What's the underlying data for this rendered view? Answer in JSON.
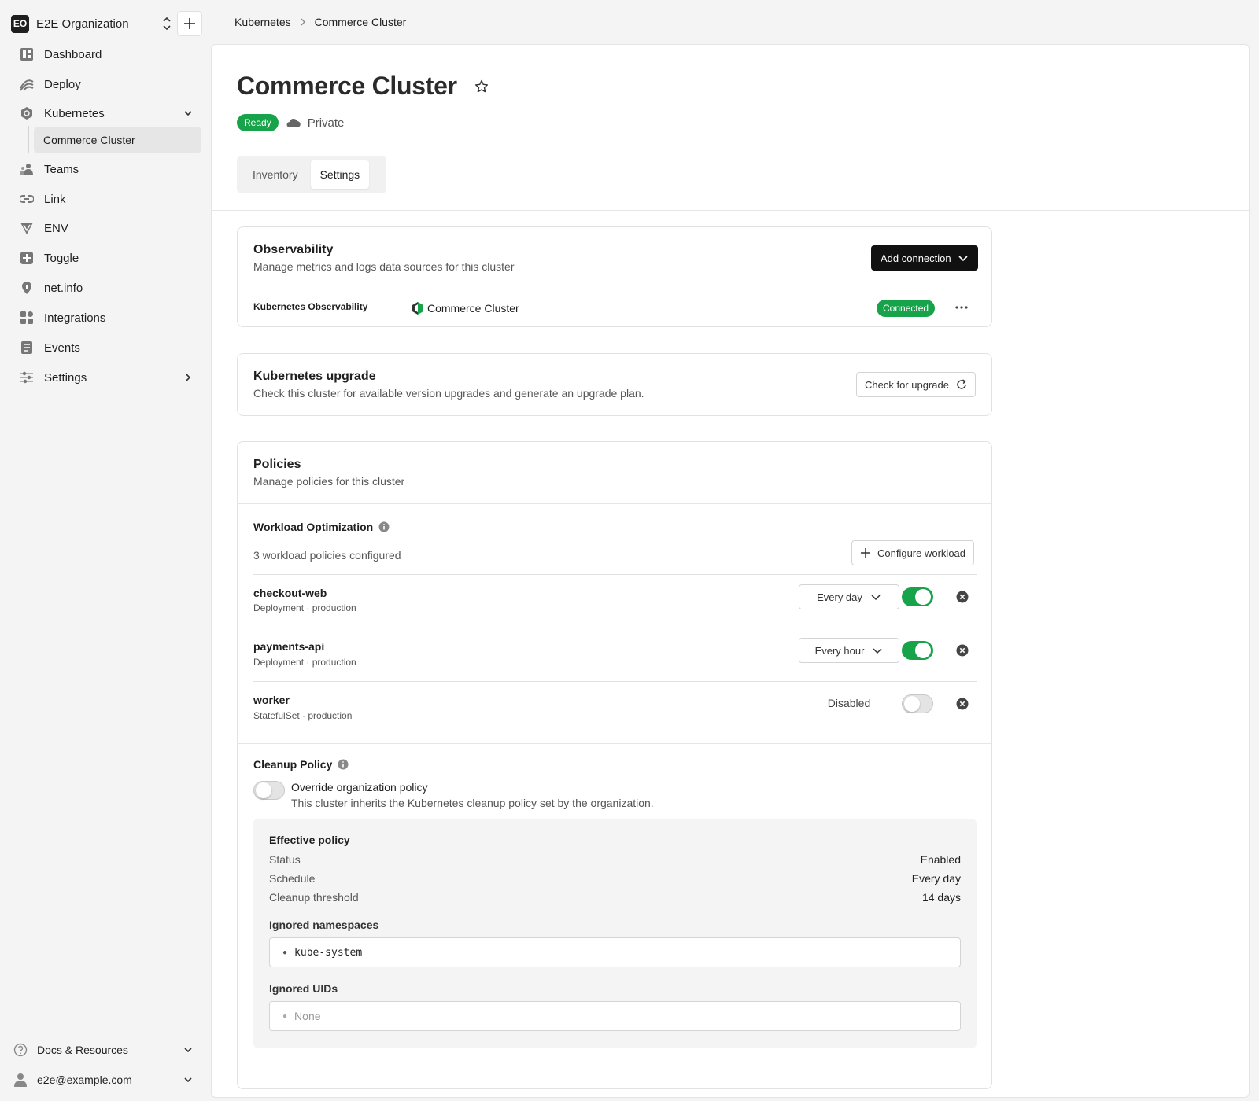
{
  "org": {
    "initials": "EO",
    "name": "E2E Organization"
  },
  "sidebar": {
    "items": [
      {
        "label": "Dashboard",
        "icon": "dashboard-icon"
      },
      {
        "label": "Deploy",
        "icon": "deploy-icon"
      },
      {
        "label": "Kubernetes",
        "icon": "kubernetes-icon"
      },
      {
        "label": "Teams",
        "icon": "teams-icon"
      },
      {
        "label": "Link",
        "icon": "link-icon"
      },
      {
        "label": "ENV",
        "icon": "env-icon"
      },
      {
        "label": "Toggle",
        "icon": "toggle-icon"
      },
      {
        "label": "net.info",
        "icon": "location-pin-icon"
      },
      {
        "label": "Integrations",
        "icon": "integrations-icon"
      },
      {
        "label": "Events",
        "icon": "events-icon"
      },
      {
        "label": "Settings",
        "icon": "settings-icon"
      }
    ],
    "sub_item": "Commerce Cluster",
    "docs": "Docs & Resources",
    "user": "e2e@example.com"
  },
  "breadcrumb": {
    "parent": "Kubernetes",
    "current": "Commerce Cluster"
  },
  "page": {
    "title": "Commerce Cluster",
    "status": "Ready",
    "visibility": "Private",
    "tabs": [
      "Inventory",
      "Settings"
    ],
    "active_tab": "Settings"
  },
  "observability": {
    "title": "Observability",
    "subtitle": "Manage metrics and logs data sources for this cluster",
    "add_button": "Add connection",
    "connection": {
      "name": "Kubernetes Observability",
      "cluster": "Commerce Cluster",
      "status": "Connected"
    }
  },
  "upgrade": {
    "title": "Kubernetes upgrade",
    "subtitle": "Check this cluster for available version upgrades and generate an upgrade plan.",
    "button": "Check for upgrade"
  },
  "policies": {
    "title": "Policies",
    "subtitle": "Manage policies for this cluster",
    "workload": {
      "title": "Workload Optimization",
      "summary": "3 workload policies configured",
      "configure_button": "Configure workload",
      "rows": [
        {
          "name": "checkout-web",
          "meta": "Deployment · production",
          "schedule": "Every day",
          "enabled": true
        },
        {
          "name": "payments-api",
          "meta": "Deployment · production",
          "schedule": "Every hour",
          "enabled": true
        },
        {
          "name": "worker",
          "meta": "StatefulSet · production",
          "schedule": "Disabled",
          "enabled": false
        }
      ]
    },
    "cleanup": {
      "title": "Cleanup Policy",
      "override_label": "Override organization policy",
      "override_desc": "This cluster inherits the Kubernetes cleanup policy set by the organization.",
      "override_enabled": false,
      "effective": {
        "title": "Effective policy",
        "status_label": "Status",
        "status_value": "Enabled",
        "schedule_label": "Schedule",
        "schedule_value": "Every day",
        "threshold_label": "Cleanup threshold",
        "threshold_value": "14 days",
        "ns_label": "Ignored namespaces",
        "ns_value": "kube-system",
        "uids_label": "Ignored UIDs",
        "uids_value": "None"
      }
    }
  }
}
